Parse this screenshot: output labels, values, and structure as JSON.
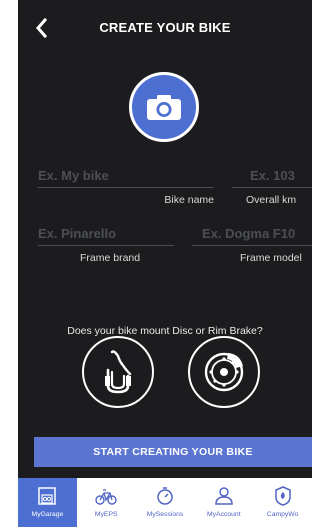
{
  "header": {
    "title": "CREATE YOUR BIKE"
  },
  "fields": {
    "bike_name": {
      "placeholder": "Ex. My bike",
      "label": "Bike name"
    },
    "overall_km": {
      "placeholder": "Ex. 103",
      "label": "Overall km"
    },
    "frame_brand": {
      "placeholder": "Ex. Pinarello",
      "label": "Frame brand"
    },
    "frame_model": {
      "placeholder": "Ex. Dogma F10",
      "label": "Frame model"
    }
  },
  "brake": {
    "question": "Does your bike mount Disc or Rim Brake?",
    "options": [
      "rim-brake-icon",
      "disc-brake-icon"
    ]
  },
  "cta": {
    "label": "START CREATING YOUR BIKE"
  },
  "tabs": [
    {
      "label": "MyGarage",
      "icon": "garage-icon",
      "active": true
    },
    {
      "label": "MyEPS",
      "icon": "bike-icon",
      "active": false
    },
    {
      "label": "MySessions",
      "icon": "stopwatch-icon",
      "active": false
    },
    {
      "label": "MyAccount",
      "icon": "user-icon",
      "active": false
    },
    {
      "label": "CampyWo",
      "icon": "campy-icon",
      "active": false
    }
  ],
  "colors": {
    "background": "#1c1c1e",
    "accent": "#4d6fd1",
    "button": "#5b75d1",
    "placeholder": "#4b4f55"
  }
}
